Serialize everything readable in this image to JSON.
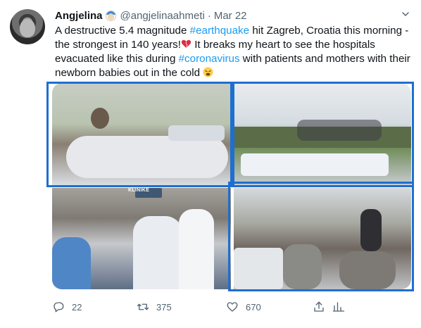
{
  "tweet": {
    "author": {
      "name": "Angjelina",
      "handle": "@angjelinaahmeti",
      "date": "Mar 22",
      "separator": "·"
    },
    "body": {
      "t1": "A destructive 5.4 magnitude ",
      "h1": "#earthquake",
      "t2": " hit Zagreb, Croatia this morning - the strongest in 140 years!",
      "t3": " It breaks my heart to see the hospitals evacuated like this during ",
      "h2": "#coronavirus",
      "t4": " with patients and mothers with their newborn babies out in the cold "
    },
    "photos": [
      {
        "name": "hospital-evacuation-photo-1",
        "sign": ""
      },
      {
        "name": "hospital-evacuation-photo-2"
      },
      {
        "name": "hospital-evacuation-photo-3",
        "sign": "KLINIKE"
      },
      {
        "name": "hospital-evacuation-photo-4"
      }
    ],
    "actions": {
      "reply_count": "22",
      "retweet_count": "375",
      "like_count": "670"
    },
    "icons": {
      "reply": "reply-icon",
      "retweet": "retweet-icon",
      "like": "heart-icon",
      "share": "share-icon",
      "analytics": "analytics-icon",
      "menu": "chevron-down-icon"
    },
    "colors": {
      "hashtag": "#1d9bf0",
      "muted": "#536471",
      "highlight": "#1e6fd0"
    }
  }
}
